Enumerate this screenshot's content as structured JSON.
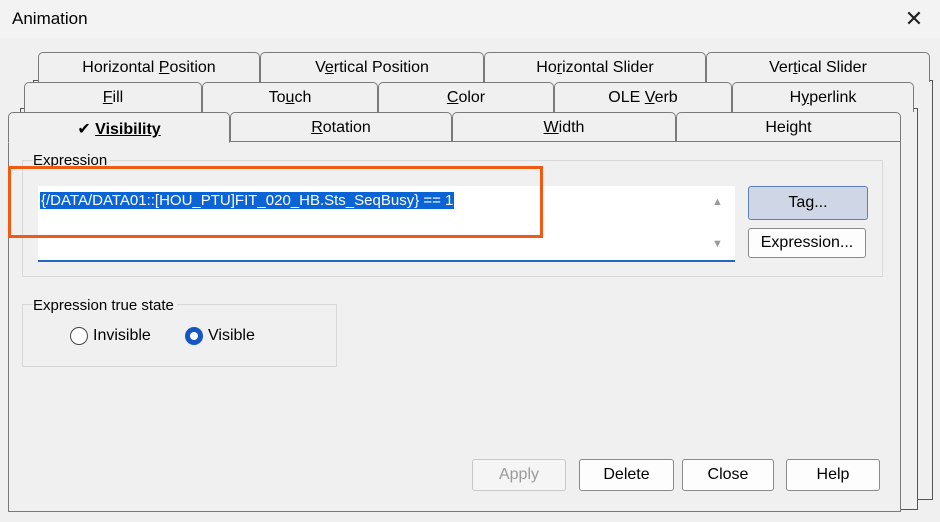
{
  "window": {
    "title": "Animation",
    "close_glyph": "✕"
  },
  "tabs": {
    "row1": [
      {
        "pre": "Horizontal ",
        "acc": "P",
        "post": "osition"
      },
      {
        "pre": "V",
        "acc": "e",
        "post": "rtical Position"
      },
      {
        "pre": "Ho",
        "acc": "r",
        "post": "izontal Slider"
      },
      {
        "pre": "Ver",
        "acc": "t",
        "post": "ical Slider"
      }
    ],
    "row2": [
      {
        "pre": "",
        "acc": "F",
        "post": "ill"
      },
      {
        "pre": "To",
        "acc": "u",
        "post": "ch"
      },
      {
        "pre": "",
        "acc": "C",
        "post": "olor"
      },
      {
        "pre": "OLE ",
        "acc": "V",
        "post": "erb"
      },
      {
        "pre": "H",
        "acc": "y",
        "post": "perlink"
      }
    ],
    "row3": [
      {
        "check": "✔",
        "pre": "",
        "acc": "V",
        "post": "isibility"
      },
      {
        "pre": "",
        "acc": "R",
        "post": "otation"
      },
      {
        "pre": "",
        "acc": "W",
        "post": "idth"
      },
      {
        "pre": "Height",
        "acc": "",
        "post": ""
      }
    ]
  },
  "expression": {
    "group_label": "Expression",
    "value": "{/DATA/DATA01::[HOU_PTU]FIT_020_HB.Sts_SeqBusy} == 1",
    "scroll_up": "▲",
    "scroll_down": "▼",
    "tag_button": "Tag...",
    "expression_button": "Expression..."
  },
  "true_state": {
    "group_label": "Expression true state",
    "options": [
      "Invisible",
      "Visible"
    ],
    "selected": "Visible"
  },
  "buttons": {
    "apply": "Apply",
    "delete": "Delete",
    "close": "Close",
    "help": "Help"
  },
  "colors": {
    "highlight": "#f05a14",
    "selection": "#0a64d6",
    "accent": "#1356c4"
  }
}
